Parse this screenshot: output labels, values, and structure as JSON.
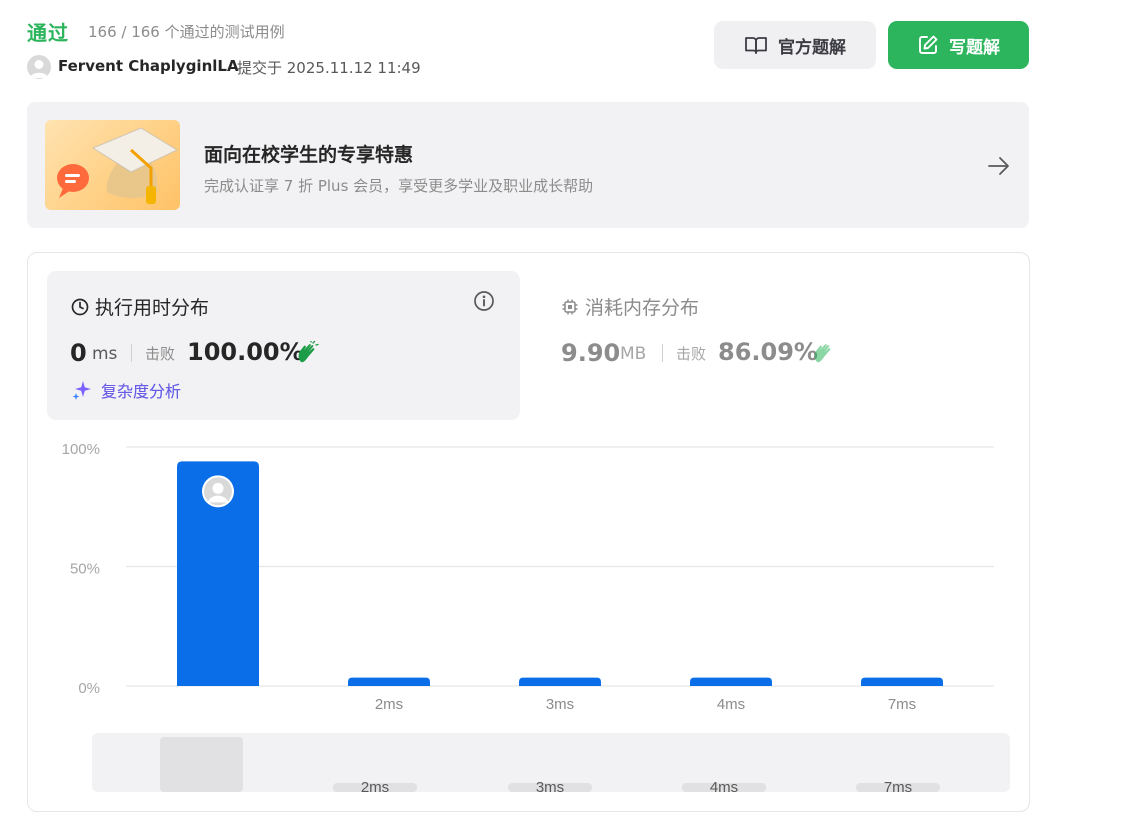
{
  "header": {
    "status": "通过",
    "cases": "166 / 166 个通过的测试用例",
    "submitter": "Fervent ChaplyginlLA",
    "submit_time": "提交于 2025.11.12 11:49",
    "official_solution": "官方题解",
    "write_solution": "写题解"
  },
  "promo": {
    "title": "面向在校学生的专享特惠",
    "subtitle": "完成认证享 7 折 Plus 会员，享受更多学业及职业成长帮助"
  },
  "runtime": {
    "title": "执行用时分布",
    "value": "0",
    "unit": "ms",
    "beats_label": "击败",
    "beats": "100.00%",
    "complexity": "复杂度分析"
  },
  "memory": {
    "title": "消耗内存分布",
    "value": "9.90",
    "unit": "MB",
    "beats_label": "击败",
    "beats": "86.09%"
  },
  "colors": {
    "accent": "#2db55d",
    "bar": "#0a6ee8",
    "grid": "#e6e6e6"
  },
  "chart_data": {
    "type": "bar",
    "categories": [
      "",
      "2ms",
      "3ms",
      "4ms",
      "7ms"
    ],
    "values": [
      94,
      3.5,
      3.5,
      3.5,
      3.5
    ],
    "ylim": [
      0,
      100
    ],
    "yticks": [
      "0%",
      "50%",
      "100%"
    ],
    "highlight_index": 0,
    "grid": true,
    "overview_labels": [
      "2ms",
      "3ms",
      "4ms",
      "7ms"
    ]
  }
}
